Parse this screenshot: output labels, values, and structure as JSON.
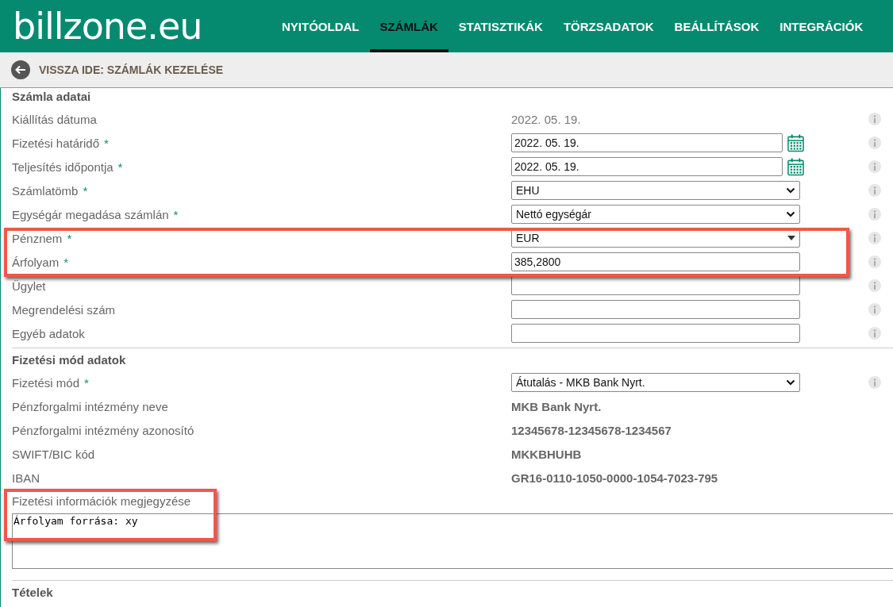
{
  "logo": "billzone.eu",
  "nav": [
    {
      "label": "NYITÓOLDAL",
      "selected": false
    },
    {
      "label": "SZÁMLÁK",
      "selected": true
    },
    {
      "label": "STATISZTIKÁK",
      "selected": false
    },
    {
      "label": "TÖRZSADATOK",
      "selected": false
    },
    {
      "label": "BEÁLLÍTÁSOK",
      "selected": false
    },
    {
      "label": "INTEGRÁCIÓK",
      "selected": false
    }
  ],
  "back_link": "VISSZA IDE: SZÁMLÁK KEZELÉSE",
  "sections": [
    {
      "title": "Számla adatai",
      "rows": [
        {
          "label": "Kiállítás dátuma",
          "kind": "text",
          "value": "2022. 05. 19.",
          "info": true
        },
        {
          "label": "Fizetési határidő",
          "required_mark": "*",
          "kind": "date",
          "value": "2022. 05. 19.",
          "info": true
        },
        {
          "label": "Teljesítés időpontja",
          "required_mark": "*",
          "kind": "date",
          "value": "2022. 05. 19.",
          "info": true
        },
        {
          "label": "Számlatömb",
          "required_mark": "*",
          "kind": "select",
          "value": "EHU",
          "info": true
        },
        {
          "label": "Egységár megadása számlán",
          "required_mark": "*",
          "kind": "select",
          "value": "Nettó egységár",
          "info": true
        },
        {
          "label": "Pénznem",
          "required_mark": "*",
          "kind": "dropdown",
          "value": "EUR",
          "info": true
        },
        {
          "label": "Árfolyam",
          "required_mark": "*",
          "kind": "input",
          "value": "385,2800",
          "info": true
        },
        {
          "label": "Ügylet",
          "kind": "input",
          "info": true
        },
        {
          "label": "Megrendelési szám",
          "kind": "input",
          "info": true
        },
        {
          "label": "Egyéb adatok",
          "kind": "input",
          "info": true
        }
      ]
    },
    {
      "title": "Fizetési mód adatok",
      "rows": [
        {
          "label": "Fizetési mód",
          "required_mark": "*",
          "kind": "select",
          "value": "Átutalás - MKB Bank Nyrt.",
          "info": true
        },
        {
          "label": "Pénzforgalmi intézmény neve",
          "kind": "bold",
          "value": "MKB Bank Nyrt.",
          "info": false
        },
        {
          "label": "Pénzforgalmi intézmény azonosító",
          "kind": "bold",
          "value": "12345678-12345678-1234567",
          "info": false
        },
        {
          "label": "SWIFT/BIC kód",
          "kind": "bold",
          "value": "MKKBHUHB",
          "info": false
        },
        {
          "label": "IBAN",
          "kind": "bold",
          "value": "GR16-0110-1050-0000-1054-7023-795",
          "info": false
        }
      ],
      "note": {
        "label": "Fizetési információk megjegyzése",
        "value": "Árfolyam forrása: xy"
      }
    },
    {
      "title": "Tételek"
    }
  ]
}
